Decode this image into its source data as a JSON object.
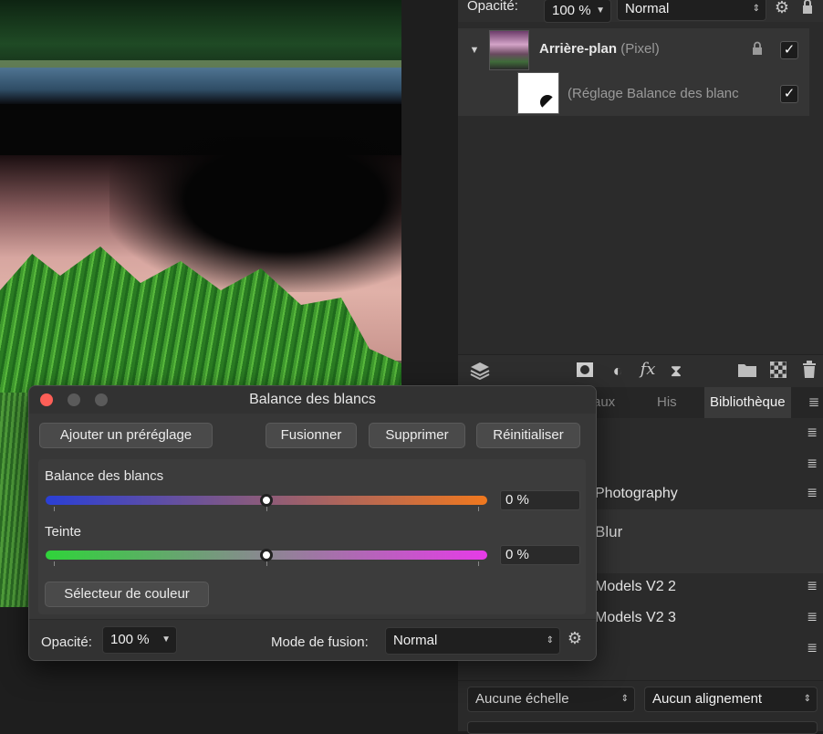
{
  "layers_panel": {
    "opacity_label": "Opacité:",
    "opacity_value": "100 %",
    "blend_mode": "Normal",
    "layers": [
      {
        "name": "Arrière-plan",
        "type": "(Pixel)"
      },
      {
        "name": "(Réglage Balance des blanc"
      }
    ]
  },
  "tabs": [
    "aux",
    "His",
    "Bibliothèque"
  ],
  "library_items": [
    "Photography",
    "Blur",
    "Models V2 2",
    "Models V2 3"
  ],
  "bottom_bar": {
    "scale": "Aucune échelle",
    "alignment": "Aucun alignement"
  },
  "dialog": {
    "title": "Balance des blancs",
    "buttons": {
      "add_preset": "Ajouter un préréglage",
      "merge": "Fusionner",
      "delete": "Supprimer",
      "reset": "Réinitialiser"
    },
    "sliders": [
      {
        "label": "Balance des blancs",
        "value": "0 %",
        "fraction": 0.5,
        "colors": [
          "#2a3fd6",
          "#f0781e"
        ]
      },
      {
        "label": "Teinte",
        "value": "0 %",
        "fraction": 0.5,
        "colors": [
          "#2fd43a",
          "#e63be8"
        ]
      }
    ],
    "color_picker": "Sélecteur de couleur",
    "footer": {
      "opacity_label": "Opacité:",
      "opacity_value": "100 %",
      "blend_label": "Mode de fusion:",
      "blend_value": "Normal"
    }
  }
}
